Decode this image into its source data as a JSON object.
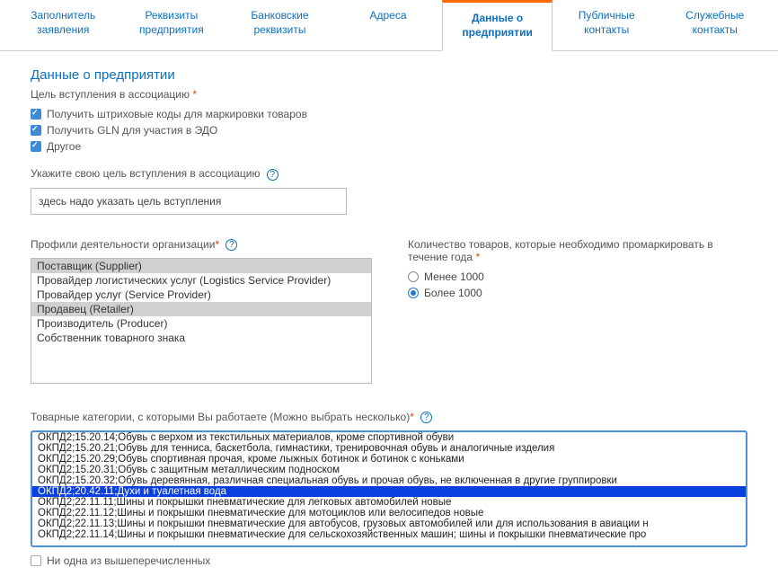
{
  "tabs": [
    {
      "l1": "Заполнитель",
      "l2": "заявления"
    },
    {
      "l1": "Реквизиты",
      "l2": "предприятия"
    },
    {
      "l1": "Банковские",
      "l2": "реквизиты"
    },
    {
      "l1": "Адреса",
      "l2": ""
    },
    {
      "l1": "Данные о",
      "l2": "предприятии"
    },
    {
      "l1": "Публичные",
      "l2": "контакты"
    },
    {
      "l1": "Служебные",
      "l2": "контакты"
    }
  ],
  "section_title": "Данные о предприятии",
  "goal_label": "Цель вступления в ассоциацию",
  "goals": [
    "Получить штриховые коды для маркировки товаров",
    "Получить GLN для участия в ЭДО",
    "Другое"
  ],
  "specify_goal_label": "Укажите свою цель вступления в ассоциацию",
  "specify_goal_value": "здесь надо указать цель вступления",
  "profiles_label": "Профили деятельности организации",
  "profiles": [
    {
      "text": "Поставщик (Supplier)",
      "sel": true
    },
    {
      "text": "Провайдер логистических услуг (Logistics Service Provider)",
      "sel": false
    },
    {
      "text": "Провайдер услуг (Service Provider)",
      "sel": false
    },
    {
      "text": "Продавец (Retailer)",
      "sel": true
    },
    {
      "text": "Производитель (Producer)",
      "sel": false
    },
    {
      "text": "Собственник товарного знака",
      "sel": false
    }
  ],
  "qty_label": "Количество товаров, которые необходимо промаркировать в течение года",
  "qty_options": [
    {
      "text": "Менее 1000",
      "checked": false
    },
    {
      "text": "Более 1000",
      "checked": true
    }
  ],
  "categories_label": "Товарные категории, с которыми Вы работаете (Можно выбрать несколько)",
  "categories": [
    {
      "text": "ОКПД2;15.20.14;Обувь с верхом из текстильных материалов, кроме спортивной обуви",
      "sel": false
    },
    {
      "text": "ОКПД2;15.20.21;Обувь для тенниса, баскетбола, гимнастики, тренировочная обувь и аналогичные изделия",
      "sel": false
    },
    {
      "text": "ОКПД2;15.20.29;Обувь спортивная прочая, кроме лыжных ботинок и ботинок с коньками",
      "sel": false
    },
    {
      "text": "ОКПД2;15.20.31;Обувь с защитным металлическим подноском",
      "sel": false
    },
    {
      "text": "ОКПД2;15.20.32;Обувь деревянная, различная специальная обувь и прочая обувь, не включенная в другие группировки",
      "sel": false
    },
    {
      "text": "ОКПД2;20.42.11;Духи и туалетная вода",
      "sel": true
    },
    {
      "text": "ОКПД2;22.11.11;Шины и покрышки пневматические для легковых автомобилей новые",
      "sel": false
    },
    {
      "text": "ОКПД2;22.11.12;Шины и покрышки пневматические для мотоциклов или велосипедов новые",
      "sel": false
    },
    {
      "text": "ОКПД2;22.11.13;Шины и покрышки пневматические для автобусов, грузовых автомобилей или для использования в авиации н",
      "sel": false
    },
    {
      "text": "ОКПД2;22.11.14;Шины и покрышки пневматические для сельскохозяйственных машин; шины и покрышки пневматические про",
      "sel": false
    }
  ],
  "none_label": "Ни одна из вышеперечисленных"
}
